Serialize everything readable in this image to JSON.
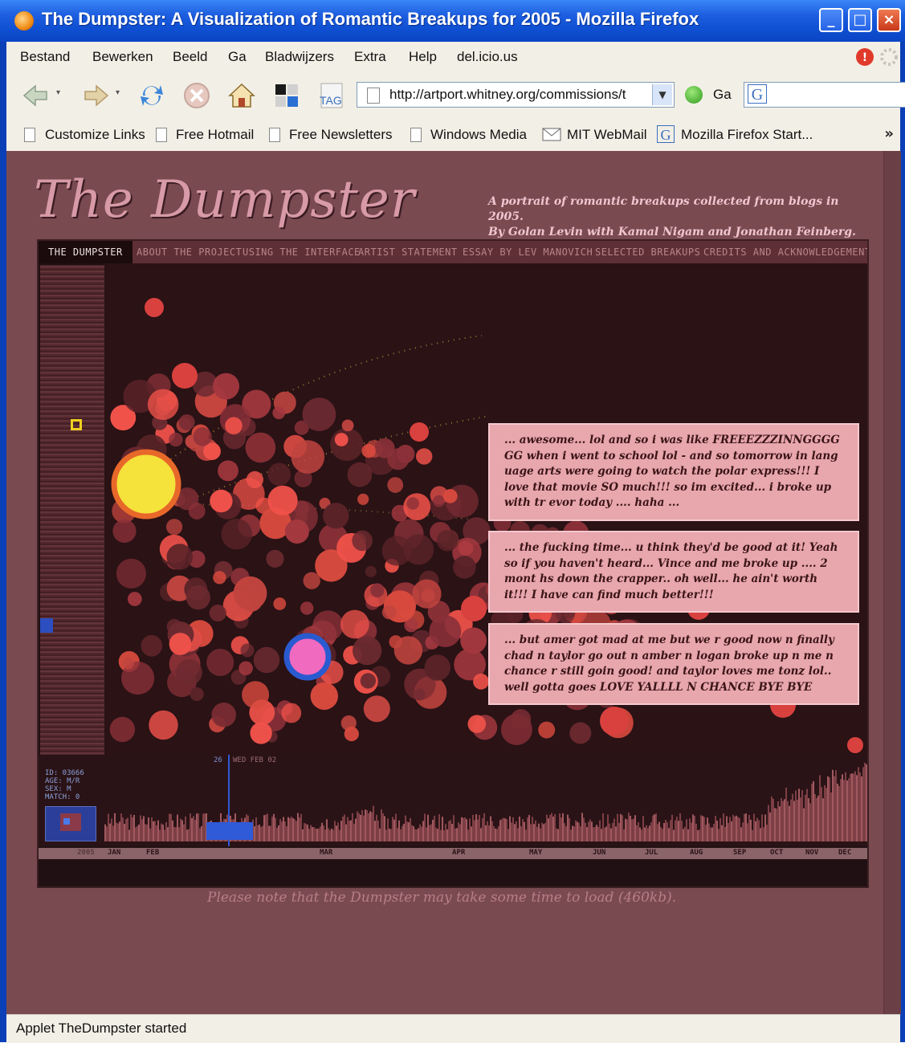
{
  "window": {
    "title": "The Dumpster: A Visualization of Romantic Breakups for 2005 - Mozilla Firefox"
  },
  "menu": [
    "Bestand",
    "Bewerken",
    "Beeld",
    "Ga",
    "Bladwijzers",
    "Extra",
    "Help",
    "del.icio.us"
  ],
  "nav": {
    "url": "http://artport.whitney.org/commissions/t",
    "go_label": "Ga",
    "tag_label": "TAG",
    "search_value": ""
  },
  "bookmarks": [
    "Customize Links",
    "Free Hotmail",
    "Free Newsletters",
    "Windows Media",
    "MIT WebMail",
    "Mozilla Firefox Start...",
    "»"
  ],
  "page": {
    "logo": "The Dumpster",
    "tagline_1": "A portrait of romantic breakups collected from blogs in 2005.",
    "tagline_2": "By Golan Levin with Kamal Nigam and Jonathan Feinberg.",
    "tabs": [
      "THE DUMPSTER",
      "ABOUT THE PROJECT",
      "USING THE INTERFACE",
      "ARTIST STATEMENT",
      "ESSAY BY LEV MANOVICH",
      "SELECTED BREAKUPS",
      "CREDITS AND ACKNOWLEDGEMENTS"
    ],
    "quotes": [
      "... awesome... lol and so i was like FREEEZZZINNGGGG GG when i went to school lol - and so tomorrow in lang uage arts were going to watch the polar express!!! I love that movie SO much!!! so im excited... i broke up with tr evor today .... haha ...",
      "... the fucking time... u think they'd be good at it! Yeah so if you haven't heard... Vince and me broke up .... 2 mont hs down the crapper.. oh well... he ain't worth it!!! I have can find much better!!!",
      "... but amer got mad at me but we r good now n finally chad n taylor go out n amber n logan broke up n me n chance r still goin good! and taylor loves me tonz lol.. well gotta goes LOVE YALLLL N CHANCE BYE BYE"
    ],
    "info_block": [
      "ID: 03666",
      "AGE: M/R",
      "SEX: M",
      "MATCH: 0"
    ],
    "marker_label": "26",
    "date_label": "WED FEB 02",
    "year": "2005",
    "months": [
      "JAN",
      "FEB",
      "MAR",
      "APR",
      "MAY",
      "JUN",
      "JUL",
      "AUG",
      "SEP",
      "OCT",
      "NOV",
      "DEC"
    ],
    "note": "Please note that the Dumpster may take some time to load (460kb)."
  },
  "status": "Applet TheDumpster started",
  "colors": {
    "page_bg": "#7a4a51",
    "applet_bg": "#211013",
    "quote_bg": "#e8a6ad",
    "accent_yellow": "#f5e33b",
    "accent_pink": "#f06ac0",
    "ring_blue": "#2a5ad0"
  }
}
